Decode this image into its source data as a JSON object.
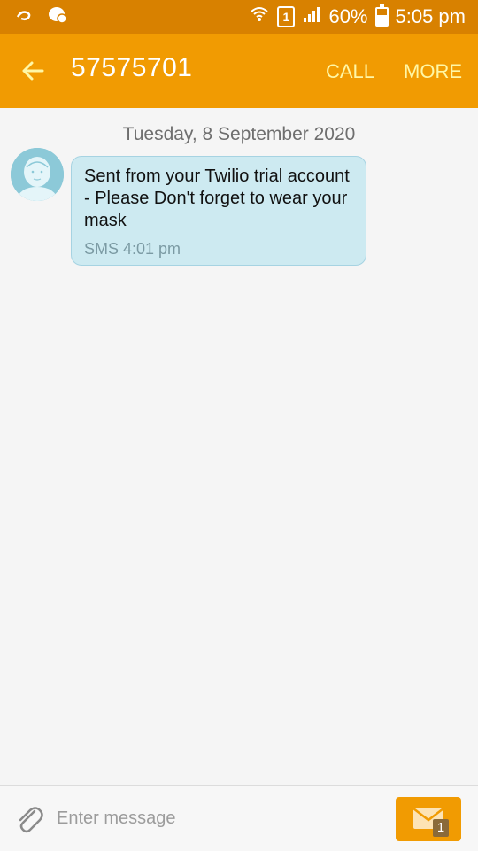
{
  "status_bar": {
    "sim_slot": "1",
    "battery": "60%",
    "time": "5:05 pm"
  },
  "app_bar": {
    "title": "57575701",
    "call_label": "CALL",
    "more_label": "MORE"
  },
  "conversation": {
    "date": "Tuesday, 8 September 2020",
    "messages": [
      {
        "text": "Sent from your Twilio trial account - Please Don't forget to wear your mask",
        "meta": "SMS 4:01 pm"
      }
    ]
  },
  "composer": {
    "placeholder": "Enter message",
    "sim_badge": "1"
  },
  "colors": {
    "status_bar": "#d88100",
    "app_bar": "#f19b02",
    "bubble": "#cdeaf1",
    "action_text": "#fff7a6"
  }
}
